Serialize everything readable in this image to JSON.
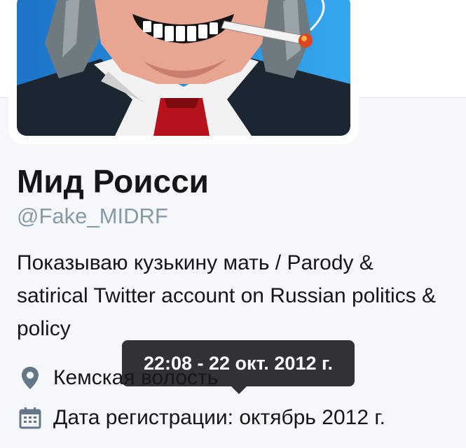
{
  "profile": {
    "display_name": "Мид Роисси",
    "handle": "@Fake_MIDRF",
    "bio": "Показываю кузькину мать / Parody & satirical Twitter account on Russian politics & policy",
    "location": "Кемская волость",
    "join_date": "Дата регистрации: октябрь 2012 г."
  },
  "tooltip": {
    "text": "22:08 - 22 окт. 2012 г."
  },
  "icons": {
    "location": "map-pin-icon",
    "join_date": "calendar-icon"
  },
  "colors": {
    "page_background": "#f5f8fa",
    "text": "#14171a",
    "secondary_text": "#8899a6",
    "icon": "#657786",
    "tooltip_background": "#14171a"
  }
}
